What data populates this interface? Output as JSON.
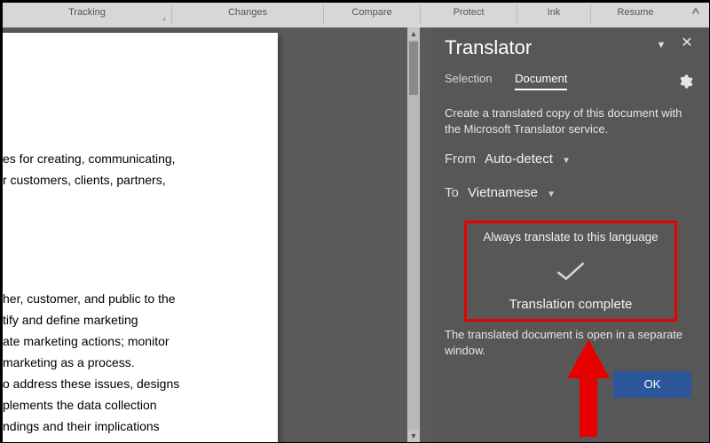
{
  "ribbon": {
    "groups": [
      "Tracking",
      "Changes",
      "Compare",
      "Protect",
      "Ink",
      "Resume"
    ]
  },
  "document": {
    "lines": [
      "es for creating, communicating,",
      "r customers, clients, partners,",
      "her, customer, and public to the",
      "tify and define marketing",
      "ate marketing actions; monitor",
      "marketing as a process.",
      "o address these issues, designs",
      "plements the data collection",
      "ndings and their implications"
    ]
  },
  "pane": {
    "title": "Translator",
    "tabs": {
      "selection": "Selection",
      "document": "Document"
    },
    "description": "Create a translated copy of this document with the Microsoft Translator service.",
    "from_label": "From",
    "from_value": "Auto-detect",
    "to_label": "To",
    "to_value": "Vietnamese",
    "always_label": "Always translate to this language",
    "complete_label": "Translation complete",
    "note": "The translated document is open in a separate window.",
    "ok": "OK"
  }
}
